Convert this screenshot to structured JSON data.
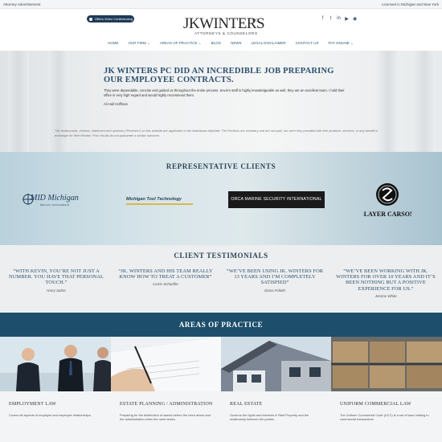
{
  "topbar": {
    "left": "Attorney Advertisement",
    "right": "Licensed in Michigan and New York"
  },
  "header": {
    "video_pill": "Offers Video Conferencing",
    "logo": {
      "name": "JKWINTERS",
      "pc": "PC",
      "tagline": "ATTORNEYS & COUNSELORS"
    },
    "social": [
      "facebook-icon",
      "twitter-icon",
      "linkedin-icon",
      "youtube-icon",
      "rss-icon"
    ],
    "social_glyphs": [
      "f",
      "t",
      "in",
      "▶",
      "◉"
    ],
    "nav": [
      "HOME",
      "OUR FIRM ⌄",
      "AREAS OF PRACTICE ⌄",
      "BLOG",
      "NEWS",
      "LEGAL DISCLAIMER",
      "CONTACT US",
      "PAY ONLINE ⌄"
    ]
  },
  "hero": {
    "title": "JK WINTERS PC DID AN INCREDIBLE JOB PREPARING OUR EMPLOYEE CONTRACTS.",
    "quote": "They were dependable, concise and guided us throughout the entire process. Kevin's staff is highly knowledgeable as well, they are an excellent team. I hold their office in very high regard and would highly recommend them.",
    "author": "Ali Hull Hoffman",
    "disclaimer": "The testimonials, reviews, statement and opinions (\"Reviews\") on this website are applicable to the individuals depicted. The Reviews are voluntary and are not paid, nor were they provided with free products, services, or any benefit in exchange for their Review. Prior results do not guarantee a similar outcome."
  },
  "clients": {
    "title": "REPRESENTATIVE CLIENTS",
    "mid_michigan": {
      "text": "MID Michigan",
      "sub": "MEDICAL MANAGEMENT"
    },
    "mich_tool": "Michigan Tool Technology",
    "orca": "ORCA MARINE SECURITY INTERNATIONAL",
    "slayer": "SLAYER CARSON"
  },
  "testimonials": {
    "title": "CLIENT TESTIMONIALS",
    "items": [
      {
        "quote": "“WITH KEVIN, YOU’RE NOT JUST A NUMBER. YOU HAVE THAT PERSONAL TOUCH.”",
        "author": "Harry Sabre"
      },
      {
        "quote": "“JK. WINTERS AND HIS TEAM REALLY KNOW HOW TO TREAT A CUSTOMER”",
        "author": "Carrie Schaeffer"
      },
      {
        "quote": "“WE’VE BEEN USING JK. WINTERS FOR 13 YEARS AND I’M COMPLETELY SATISFIED”",
        "author": "Diana Folieth"
      },
      {
        "quote": "“WE’VE BEEN WORKING WITH JK. WINTERS FOR OVER 10 YEARS AND IT’S BEEN NOTHING BUT A POSITIVE EXPERIENCE FOR US.”",
        "author": "Jerome White"
      }
    ]
  },
  "practice": {
    "title": "AREAS OF PRACTICE",
    "items": [
      {
        "title": "EMPLOYMENT LAW",
        "desc": "Covers all aspects of employer and employee relationships."
      },
      {
        "title": "ESTATE PLANNING / ADMINISTRATION",
        "desc": "Preparing for the distribution of assets before the need arises and the administration when the need arises."
      },
      {
        "title": "REAL ESTATE",
        "desc": "Governs the rights and interests in Real Property and the relationship between the parties."
      },
      {
        "title": "UNIFORM COMMERCIAL LAW",
        "desc": "The Uniform Commercial Code (UCC) is a set of laws relating to commercial transactions"
      }
    ]
  },
  "colors": {
    "navy": "#1d4e6b",
    "heading_blue": "#2c4f6e",
    "pill": "#1f3a57"
  }
}
